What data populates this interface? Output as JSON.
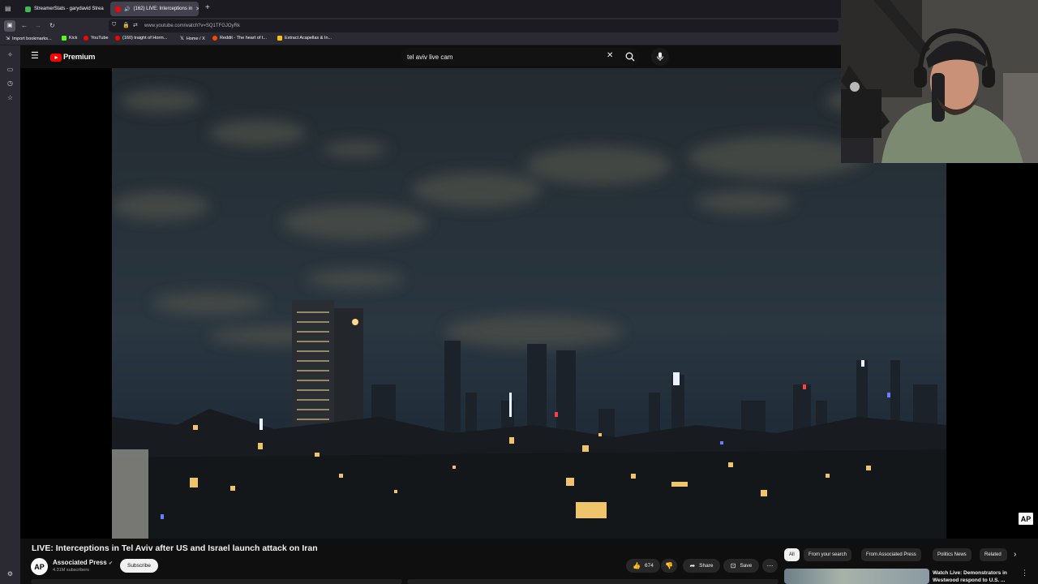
{
  "browser": {
    "tabs": [
      {
        "title": "StreamerStats - garydavid Strea",
        "favicon_color": "#3fb950"
      },
      {
        "title": "(162) LIVE: Interceptions in",
        "favicon_color": "#ff0000"
      }
    ],
    "new_tab_label": "+",
    "url": "www.youtube.com/watch?v=SQ1TFGJOyRk",
    "bookmarks": [
      {
        "label": "Import bookmarks...",
        "icon_color": "#9a9aa5"
      },
      {
        "label": "Kick",
        "icon_color": "#53fc18"
      },
      {
        "label": "YouTube",
        "icon_color": "#ff0000"
      },
      {
        "label": "(160) traight of Horm...",
        "icon_color": "#ff0000"
      },
      {
        "label": "Home / X",
        "icon_color": "#ffffff"
      },
      {
        "label": "Reddit - The heart of t...",
        "icon_color": "#ff4500"
      },
      {
        "label": "Extract Acapellas & In...",
        "icon_color": "#f5c211"
      }
    ]
  },
  "youtube": {
    "logo_text": "Premium",
    "search_query": "tel aviv live cam",
    "video": {
      "title": "LIVE: Interceptions in Tel Aviv after US and Israel launch attack on Iran",
      "watermark": "AP"
    },
    "channel": {
      "avatar_text": "AP",
      "name": "Associated Press",
      "subscribers": "4.31M subscribers",
      "subscribe_label": "Subscribe"
    },
    "actions": {
      "likes": "674",
      "share_label": "Share",
      "save_label": "Save"
    },
    "chips": [
      "All",
      "From your search",
      "From Associated Press",
      "Politics News",
      "Related"
    ],
    "recommendation": {
      "title": "Watch Live: Demonstrators in Westwood respond to U.S. ..."
    }
  },
  "colors": {
    "youtube_red": "#ff0000",
    "background": "#0f0f0f",
    "chip_bg": "#272727"
  }
}
